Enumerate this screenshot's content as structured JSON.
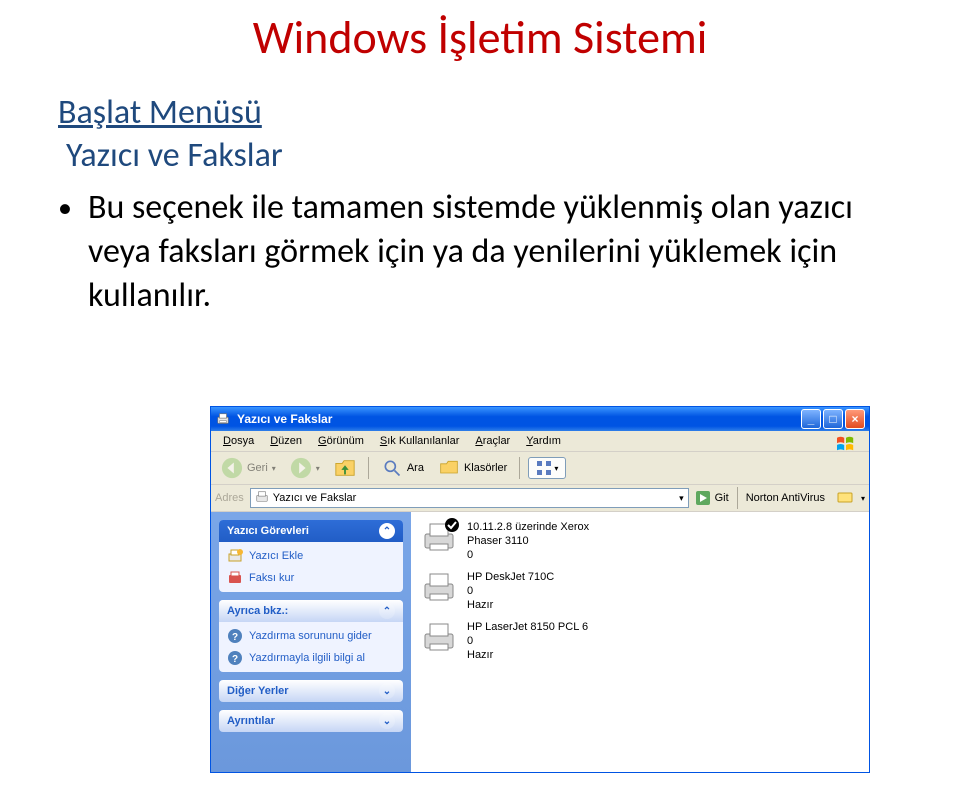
{
  "title": "Windows İşletim Sistemi",
  "subtitle1": "Başlat Menüsü",
  "subtitle2": "Yazıcı ve Fakslar",
  "bullet": "Bu seçenek ile tamamen sistemde yüklenmiş olan yazıcı veya faksları görmek için ya da yenilerini yüklemek için kullanılır.",
  "window": {
    "title": "Yazıcı ve Fakslar",
    "controls": {
      "min": "_",
      "max": "□",
      "close": "×"
    },
    "menu": [
      "Dosya",
      "Düzen",
      "Görünüm",
      "Sık Kullanılanlar",
      "Araçlar",
      "Yardım"
    ],
    "toolbar": {
      "back": "Geri",
      "search": "Ara",
      "folders": "Klasörler"
    },
    "address": {
      "label": "Adres",
      "value": "Yazıcı ve Fakslar",
      "go": "Git",
      "nav": "Norton AntiVirus"
    },
    "sidebar": {
      "tasks": {
        "header": "Yazıcı Görevleri",
        "items": [
          "Yazıcı Ekle",
          "Faksı kur"
        ]
      },
      "seealso": {
        "header": "Ayrıca bkz.:",
        "items": [
          "Yazdırma sorununu gider",
          "Yazdırmayla ilgili bilgi al"
        ]
      },
      "other": {
        "header": "Diğer Yerler"
      },
      "details": {
        "header": "Ayrıntılar"
      }
    },
    "printers": [
      {
        "name_line1": "10.11.2.8 üzerinde Xerox",
        "name_line2": "Phaser 3110",
        "status": "0",
        "default": true
      },
      {
        "name_line1": "HP DeskJet 710C",
        "name_line2": "",
        "status_line1": "0",
        "status_line2": "Hazır",
        "default": false
      },
      {
        "name_line1": "HP LaserJet 8150 PCL 6",
        "name_line2": "",
        "status_line1": "0",
        "status_line2": "Hazır",
        "default": false
      }
    ]
  }
}
